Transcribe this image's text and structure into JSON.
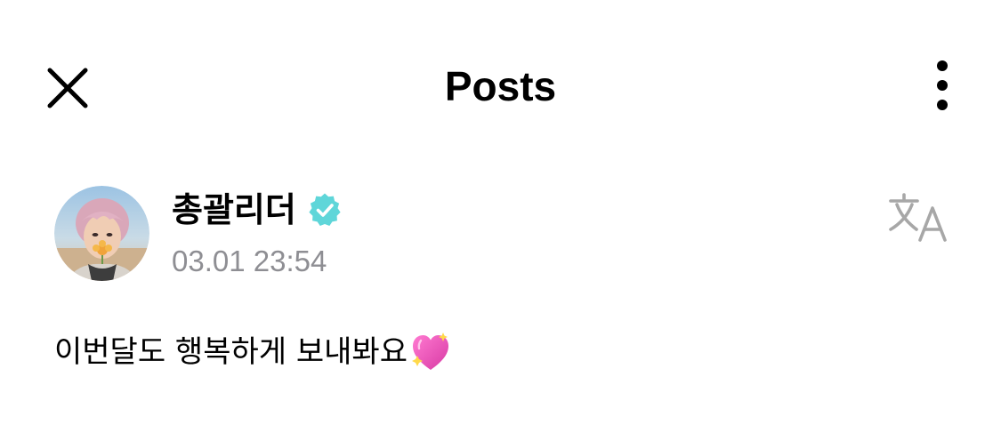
{
  "header": {
    "title": "Posts",
    "close_icon": "close-icon",
    "more_icon": "more-vertical-icon"
  },
  "post": {
    "author": {
      "name": "총괄리더",
      "verified": true,
      "avatar_icon": "avatar"
    },
    "timestamp": "03.01 23:54",
    "text": "이번달도 행복하게 보내봐요",
    "emoji": "💖",
    "translate_icon": "translate-icon"
  },
  "colors": {
    "verified_badge": "#5fd6d9",
    "timestamp": "#8e8e93",
    "translate_icon": "#a7a7a7",
    "text": "#000000"
  }
}
